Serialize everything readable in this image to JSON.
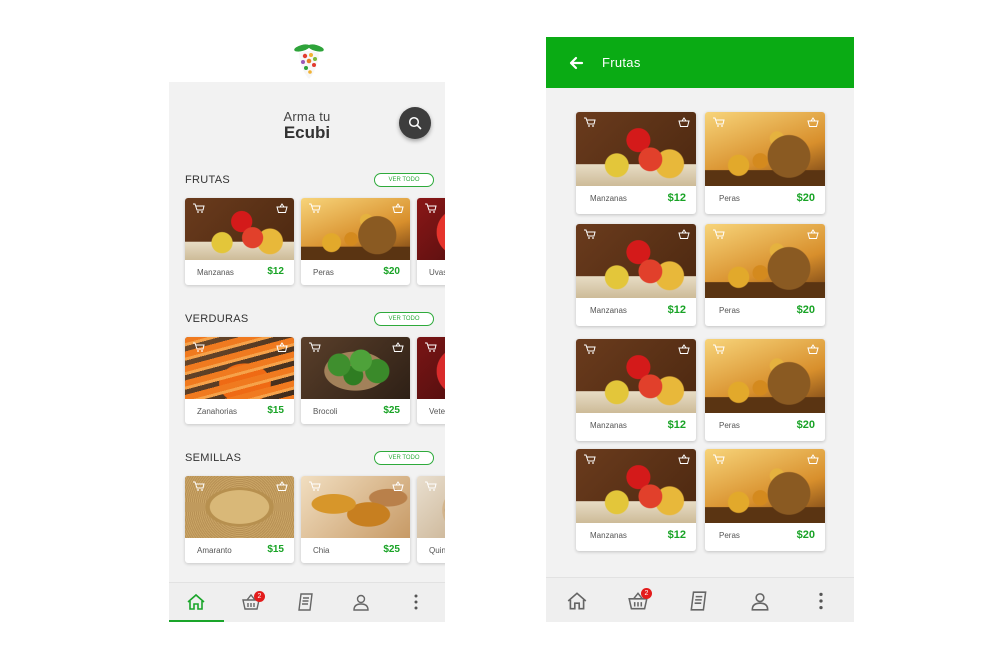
{
  "home": {
    "title_line1": "Arma tu",
    "title_line2": "Ecubi",
    "sections": [
      {
        "title": "FRUTAS",
        "see_all": "VER TODO",
        "items": [
          {
            "name": "Manzanas",
            "price": "$12"
          },
          {
            "name": "Peras",
            "price": "$20"
          },
          {
            "name": "Uvas",
            "price": ""
          }
        ]
      },
      {
        "title": "VERDURAS",
        "see_all": "VER TODO",
        "items": [
          {
            "name": "Zanahorias",
            "price": "$15"
          },
          {
            "name": "Brocoli",
            "price": "$25"
          },
          {
            "name": "Veter",
            "price": ""
          }
        ]
      },
      {
        "title": "SEMILLAS",
        "see_all": "VER TODO",
        "items": [
          {
            "name": "Amaranto",
            "price": "$15"
          },
          {
            "name": "Chia",
            "price": "$25"
          },
          {
            "name": "Quin",
            "price": ""
          }
        ]
      }
    ],
    "cart_badge": "2"
  },
  "category": {
    "title": "Frutas",
    "items": [
      {
        "name": "Manzanas",
        "price": "$12"
      },
      {
        "name": "Peras",
        "price": "$20"
      },
      {
        "name": "Manzanas",
        "price": "$12"
      },
      {
        "name": "Peras",
        "price": "$20"
      },
      {
        "name": "Manzanas",
        "price": "$12"
      },
      {
        "name": "Peras",
        "price": "$20"
      },
      {
        "name": "Manzanas",
        "price": "$12"
      },
      {
        "name": "Peras",
        "price": "$20"
      }
    ],
    "cart_badge": "2"
  },
  "colors": {
    "brand_green": "#0aab14",
    "price_green": "#19a326",
    "badge_red": "#e31b1b",
    "search_button": "#3d3d3d"
  },
  "icons": {
    "logo": "fruit-logo-icon",
    "search": "search-icon",
    "back": "arrow-left-icon",
    "home": "home-icon",
    "cart": "basket-icon",
    "orders": "receipt-icon",
    "profile": "user-icon",
    "more": "more-vertical-icon"
  }
}
